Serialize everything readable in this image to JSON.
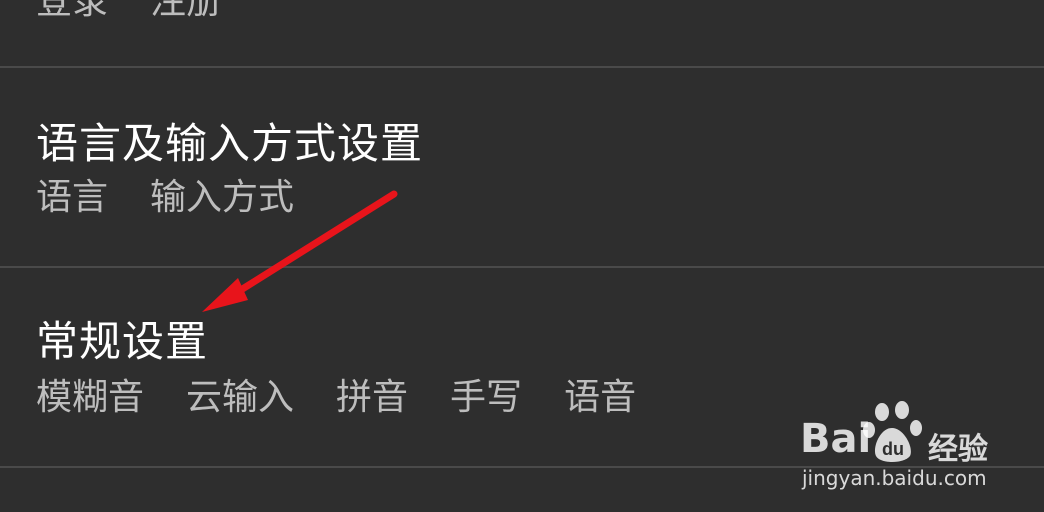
{
  "account": {
    "subs": [
      "登录",
      "注册"
    ]
  },
  "language_section": {
    "title": "语言及输入方式设置",
    "subs": [
      "语言",
      "输入方式"
    ]
  },
  "general_section": {
    "title": "常规设置",
    "subs": [
      "模糊音",
      "云输入",
      "拼音",
      "手写",
      "语音"
    ]
  },
  "annotation": {
    "arrow_color": "#e8141b"
  },
  "watermark": {
    "brand": "Bai  du",
    "product": "经验",
    "url": "jingyan.baidu.com"
  },
  "colors": {
    "background": "#2e2e2e",
    "divider": "#4a4a4a",
    "title": "#ffffff",
    "subtitle": "#bdbdbd"
  }
}
